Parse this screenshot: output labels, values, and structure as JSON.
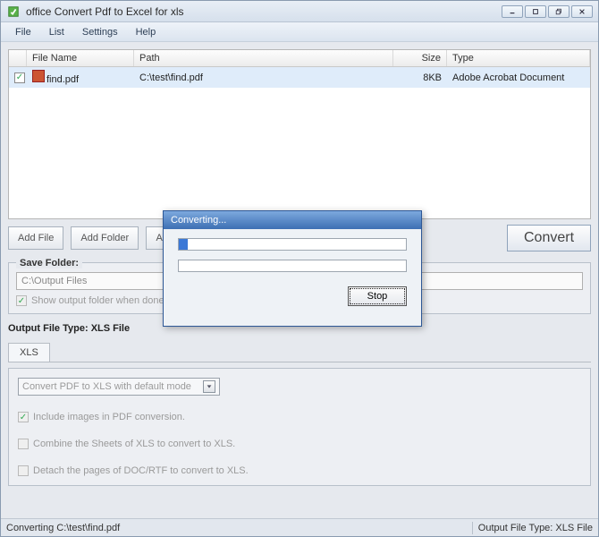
{
  "window": {
    "title": "office Convert Pdf to Excel for xls"
  },
  "menu": {
    "file": "File",
    "list": "List",
    "settings": "Settings",
    "help": "Help"
  },
  "filelist": {
    "headers": {
      "name": "File Name",
      "path": "Path",
      "size": "Size",
      "type": "Type"
    },
    "rows": [
      {
        "name": "find.pdf",
        "path": "C:\\test\\find.pdf",
        "size": "8KB",
        "type": "Adobe Acrobat Document"
      }
    ]
  },
  "buttons": {
    "add_file": "Add File",
    "add_folder": "Add Folder",
    "a3": "A",
    "convert": "Convert"
  },
  "save": {
    "group_label": "Save Folder:",
    "path": "C:\\Output Files",
    "show_output_label": "Show output folder when done."
  },
  "output": {
    "label_prefix": "Output File Type:  ",
    "label_value": "XLS File",
    "tab": "XLS",
    "mode": "Convert PDF to XLS with default mode",
    "opt_images": "Include images in PDF conversion.",
    "opt_combine": "Combine the Sheets of XLS to convert to XLS.",
    "opt_detach": "Detach the pages of DOC/RTF to convert to XLS."
  },
  "dialog": {
    "title": "Converting...",
    "stop": "Stop"
  },
  "status": {
    "left": "Converting  C:\\test\\find.pdf",
    "right_prefix": "Output File Type:  ",
    "right_value": "XLS File"
  }
}
